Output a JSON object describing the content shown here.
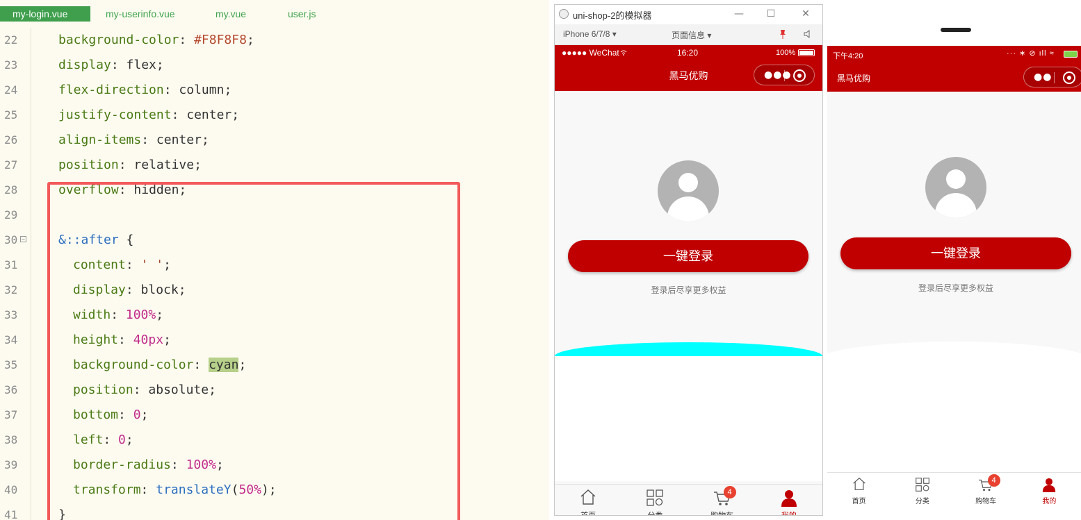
{
  "editor": {
    "tabs": [
      {
        "label": "my-login.vue",
        "active": true
      },
      {
        "label": "my-userinfo.vue",
        "active": false
      },
      {
        "label": "my.vue",
        "active": false
      },
      {
        "label": "user.js",
        "active": false
      }
    ],
    "lines": [
      {
        "num": "22",
        "t": [
          [
            "prop",
            "background-color"
          ],
          [
            "pun",
            ": "
          ],
          [
            "hex",
            "#F8F8F8"
          ],
          [
            "pun",
            ";"
          ]
        ]
      },
      {
        "num": "23",
        "t": [
          [
            "prop",
            "display"
          ],
          [
            "pun",
            ": "
          ],
          [
            "val",
            "flex"
          ],
          [
            "pun",
            ";"
          ]
        ]
      },
      {
        "num": "24",
        "t": [
          [
            "prop",
            "flex-direction"
          ],
          [
            "pun",
            ": "
          ],
          [
            "val",
            "column"
          ],
          [
            "pun",
            ";"
          ]
        ]
      },
      {
        "num": "25",
        "t": [
          [
            "prop",
            "justify-content"
          ],
          [
            "pun",
            ": "
          ],
          [
            "val",
            "center"
          ],
          [
            "pun",
            ";"
          ]
        ]
      },
      {
        "num": "26",
        "t": [
          [
            "prop",
            "align-items"
          ],
          [
            "pun",
            ": "
          ],
          [
            "val",
            "center"
          ],
          [
            "pun",
            ";"
          ]
        ]
      },
      {
        "num": "27",
        "t": [
          [
            "prop",
            "position"
          ],
          [
            "pun",
            ": "
          ],
          [
            "val",
            "relative"
          ],
          [
            "pun",
            ";"
          ]
        ]
      },
      {
        "num": "28",
        "t": [
          [
            "prop",
            "overflow"
          ],
          [
            "pun",
            ": "
          ],
          [
            "val",
            "hidden"
          ],
          [
            "pun",
            ";"
          ]
        ]
      },
      {
        "num": "29",
        "t": []
      },
      {
        "num": "30",
        "fold": true,
        "t": [
          [
            "sel",
            "&::after"
          ],
          [
            "pun",
            " {"
          ]
        ]
      },
      {
        "num": "31",
        "indent": true,
        "t": [
          [
            "prop",
            "content"
          ],
          [
            "pun",
            ": "
          ],
          [
            "str",
            "' '"
          ],
          [
            "pun",
            ";"
          ]
        ]
      },
      {
        "num": "32",
        "indent": true,
        "t": [
          [
            "prop",
            "display"
          ],
          [
            "pun",
            ": "
          ],
          [
            "val",
            "block"
          ],
          [
            "pun",
            ";"
          ]
        ]
      },
      {
        "num": "33",
        "indent": true,
        "t": [
          [
            "prop",
            "width"
          ],
          [
            "pun",
            ": "
          ],
          [
            "num",
            "100%"
          ],
          [
            "pun",
            ";"
          ]
        ]
      },
      {
        "num": "34",
        "indent": true,
        "t": [
          [
            "prop",
            "height"
          ],
          [
            "pun",
            ": "
          ],
          [
            "num",
            "40px"
          ],
          [
            "pun",
            ";"
          ]
        ]
      },
      {
        "num": "35",
        "indent": true,
        "t": [
          [
            "prop",
            "background-color"
          ],
          [
            "pun",
            ": "
          ],
          [
            "hl",
            "cyan"
          ],
          [
            "pun",
            ";"
          ]
        ]
      },
      {
        "num": "36",
        "indent": true,
        "t": [
          [
            "prop",
            "position"
          ],
          [
            "pun",
            ": "
          ],
          [
            "val",
            "absolute"
          ],
          [
            "pun",
            ";"
          ]
        ]
      },
      {
        "num": "37",
        "indent": true,
        "t": [
          [
            "prop",
            "bottom"
          ],
          [
            "pun",
            ": "
          ],
          [
            "num",
            "0"
          ],
          [
            "pun",
            ";"
          ]
        ]
      },
      {
        "num": "38",
        "indent": true,
        "t": [
          [
            "prop",
            "left"
          ],
          [
            "pun",
            ": "
          ],
          [
            "num",
            "0"
          ],
          [
            "pun",
            ";"
          ]
        ]
      },
      {
        "num": "39",
        "indent": true,
        "t": [
          [
            "prop",
            "border-radius"
          ],
          [
            "pun",
            ": "
          ],
          [
            "num",
            "100%"
          ],
          [
            "pun",
            ";"
          ]
        ]
      },
      {
        "num": "40",
        "indent": true,
        "t": [
          [
            "prop",
            "transform"
          ],
          [
            "pun",
            ": "
          ],
          [
            "fn",
            "translateY"
          ],
          [
            "pun",
            "("
          ],
          [
            "num",
            "50%"
          ],
          [
            "pun",
            ");"
          ]
        ]
      },
      {
        "num": "41",
        "t": [
          [
            "pun",
            "}"
          ]
        ]
      }
    ]
  },
  "simulator": {
    "title": "uni-shop-2的模拟器",
    "device": "iPhone 6/7/8 ▾",
    "page_info": "页面信息 ▾",
    "status": {
      "carrier": "●●●●● WeChat",
      "time": "16:20",
      "battery": "100%"
    },
    "nav_title": "黑马优购",
    "login_button": "一键登录",
    "login_tip": "登录后尽享更多权益",
    "arc_color": "#00ffff",
    "tabbar": [
      {
        "label": "首页",
        "icon": "home-icon"
      },
      {
        "label": "分类",
        "icon": "grid-icon"
      },
      {
        "label": "购物车",
        "icon": "cart-icon",
        "badge": "4"
      },
      {
        "label": "我的",
        "icon": "user-icon",
        "active": true
      }
    ]
  },
  "phone": {
    "status_time": "下午4:20",
    "nav_title": "黑马优购",
    "login_button": "一键登录",
    "login_tip": "登录后尽享更多权益",
    "tabbar": [
      {
        "label": "首页"
      },
      {
        "label": "分类"
      },
      {
        "label": "购物车",
        "badge": "4"
      },
      {
        "label": "我的"
      }
    ]
  },
  "colors": {
    "brand_red": "#c00000",
    "editor_bg": "#fdfbf0",
    "highlight_box": "#f25a5a"
  }
}
